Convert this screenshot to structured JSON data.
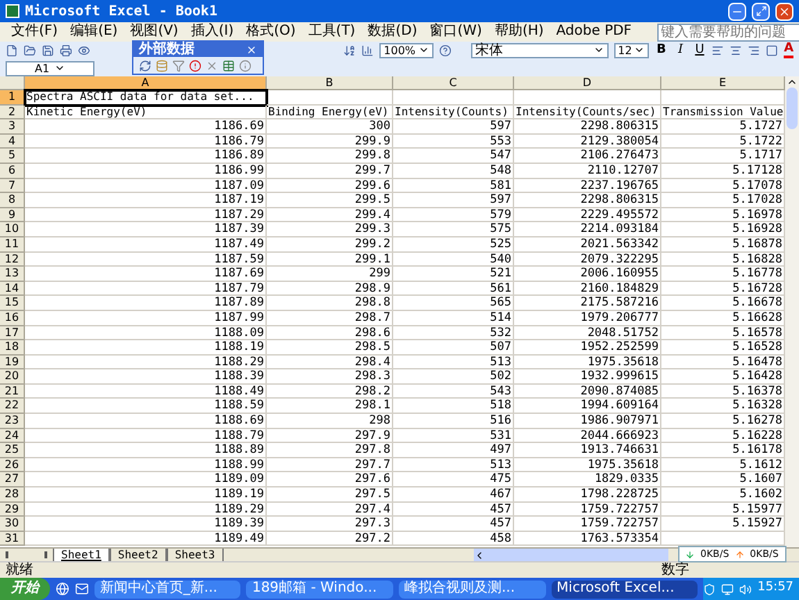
{
  "window": {
    "title": "Microsoft Excel - Book1"
  },
  "menu": [
    "文件(F)",
    "编辑(E)",
    "视图(V)",
    "插入(I)",
    "格式(O)",
    "工具(T)",
    "数据(D)",
    "窗口(W)",
    "帮助(H)",
    "Adobe PDF"
  ],
  "help_field": {
    "placeholder": "键入需要帮助的问题"
  },
  "toolbar": {
    "zoom": "100%",
    "font": "宋体",
    "size": "12",
    "bold": "B",
    "italic": "I",
    "underline": "U",
    "font_color": "A"
  },
  "floating_toolbar": {
    "title": "外部数据"
  },
  "name_box": "A1",
  "columns": [
    {
      "label": "A",
      "selected": true
    },
    {
      "label": "B",
      "selected": false
    },
    {
      "label": "C",
      "selected": false
    },
    {
      "label": "D",
      "selected": false
    },
    {
      "label": "E",
      "selected": false
    }
  ],
  "rows": [
    {
      "number": "1",
      "selected": true,
      "cells": [
        "Spectra ASCII data for data set..."
      ]
    },
    {
      "number": "2",
      "selected": false,
      "cells": [
        "Kinetic Energy(eV)",
        "Binding Energy(eV)",
        "Intensity(Counts)",
        "Intensity(Counts/sec)",
        "Transmission Value"
      ]
    },
    {
      "number": "3",
      "selected": false,
      "cells": [
        "1186.69",
        "300",
        "597",
        "2298.806315",
        "5.1727"
      ]
    },
    {
      "number": "4",
      "selected": false,
      "cells": [
        "1186.79",
        "299.9",
        "553",
        "2129.380054",
        "5.1722"
      ]
    },
    {
      "number": "5",
      "selected": false,
      "cells": [
        "1186.89",
        "299.8",
        "547",
        "2106.276473",
        "5.1717"
      ]
    },
    {
      "number": "6",
      "selected": false,
      "cells": [
        "1186.99",
        "299.7",
        "548",
        "2110.12707",
        "5.17128"
      ]
    },
    {
      "number": "7",
      "selected": false,
      "cells": [
        "1187.09",
        "299.6",
        "581",
        "2237.196765",
        "5.17078"
      ]
    },
    {
      "number": "8",
      "selected": false,
      "cells": [
        "1187.19",
        "299.5",
        "597",
        "2298.806315",
        "5.17028"
      ]
    },
    {
      "number": "9",
      "selected": false,
      "cells": [
        "1187.29",
        "299.4",
        "579",
        "2229.495572",
        "5.16978"
      ]
    },
    {
      "number": "10",
      "selected": false,
      "cells": [
        "1187.39",
        "299.3",
        "575",
        "2214.093184",
        "5.16928"
      ]
    },
    {
      "number": "11",
      "selected": false,
      "cells": [
        "1187.49",
        "299.2",
        "525",
        "2021.563342",
        "5.16878"
      ]
    },
    {
      "number": "12",
      "selected": false,
      "cells": [
        "1187.59",
        "299.1",
        "540",
        "2079.322295",
        "5.16828"
      ]
    },
    {
      "number": "13",
      "selected": false,
      "cells": [
        "1187.69",
        "299",
        "521",
        "2006.160955",
        "5.16778"
      ]
    },
    {
      "number": "14",
      "selected": false,
      "cells": [
        "1187.79",
        "298.9",
        "561",
        "2160.184829",
        "5.16728"
      ]
    },
    {
      "number": "15",
      "selected": false,
      "cells": [
        "1187.89",
        "298.8",
        "565",
        "2175.587216",
        "5.16678"
      ]
    },
    {
      "number": "16",
      "selected": false,
      "cells": [
        "1187.99",
        "298.7",
        "514",
        "1979.206777",
        "5.16628"
      ]
    },
    {
      "number": "17",
      "selected": false,
      "cells": [
        "1188.09",
        "298.6",
        "532",
        "2048.51752",
        "5.16578"
      ]
    },
    {
      "number": "18",
      "selected": false,
      "cells": [
        "1188.19",
        "298.5",
        "507",
        "1952.252599",
        "5.16528"
      ]
    },
    {
      "number": "19",
      "selected": false,
      "cells": [
        "1188.29",
        "298.4",
        "513",
        "1975.35618",
        "5.16478"
      ]
    },
    {
      "number": "20",
      "selected": false,
      "cells": [
        "1188.39",
        "298.3",
        "502",
        "1932.999615",
        "5.16428"
      ]
    },
    {
      "number": "21",
      "selected": false,
      "cells": [
        "1188.49",
        "298.2",
        "543",
        "2090.874085",
        "5.16378"
      ]
    },
    {
      "number": "22",
      "selected": false,
      "cells": [
        "1188.59",
        "298.1",
        "518",
        "1994.609164",
        "5.16328"
      ]
    },
    {
      "number": "23",
      "selected": false,
      "cells": [
        "1188.69",
        "298",
        "516",
        "1986.907971",
        "5.16278"
      ]
    },
    {
      "number": "24",
      "selected": false,
      "cells": [
        "1188.79",
        "297.9",
        "531",
        "2044.666923",
        "5.16228"
      ]
    },
    {
      "number": "25",
      "selected": false,
      "cells": [
        "1188.89",
        "297.8",
        "497",
        "1913.746631",
        "5.16178"
      ]
    },
    {
      "number": "26",
      "selected": false,
      "cells": [
        "1188.99",
        "297.7",
        "513",
        "1975.35618",
        "5.1612"
      ]
    },
    {
      "number": "27",
      "selected": false,
      "cells": [
        "1189.09",
        "297.6",
        "475",
        "1829.0335",
        "5.1607"
      ]
    },
    {
      "number": "28",
      "selected": false,
      "cells": [
        "1189.19",
        "297.5",
        "467",
        "1798.228725",
        "5.1602"
      ]
    },
    {
      "number": "29",
      "selected": false,
      "cells": [
        "1189.29",
        "297.4",
        "457",
        "1759.722757",
        "5.15977"
      ]
    },
    {
      "number": "30",
      "selected": false,
      "cells": [
        "1189.39",
        "297.3",
        "457",
        "1759.722757",
        "5.15927"
      ]
    },
    {
      "number": "31",
      "selected": false,
      "cells": [
        "1189.49",
        "297.2",
        "458",
        "1763.573354"
      ]
    }
  ],
  "sheet_tabs": [
    {
      "label": "Sheet1",
      "selected": true
    },
    {
      "label": "Sheet2",
      "selected": false
    },
    {
      "label": "Sheet3",
      "selected": false
    }
  ],
  "network_widget": {
    "download": "0KB/S",
    "upload": "0KB/S"
  },
  "status_bar": {
    "left": "就绪",
    "mode": "数字"
  },
  "taskbar": {
    "start": "开始",
    "items": [
      {
        "label": "新闻中心首页_新...",
        "selected": false
      },
      {
        "label": "189邮箱 - Windo...",
        "selected": false
      },
      {
        "label": "峰拟合视则及测...",
        "selected": false
      },
      {
        "label": "Microsoft Excel...",
        "selected": true
      }
    ],
    "time": "15:57"
  }
}
